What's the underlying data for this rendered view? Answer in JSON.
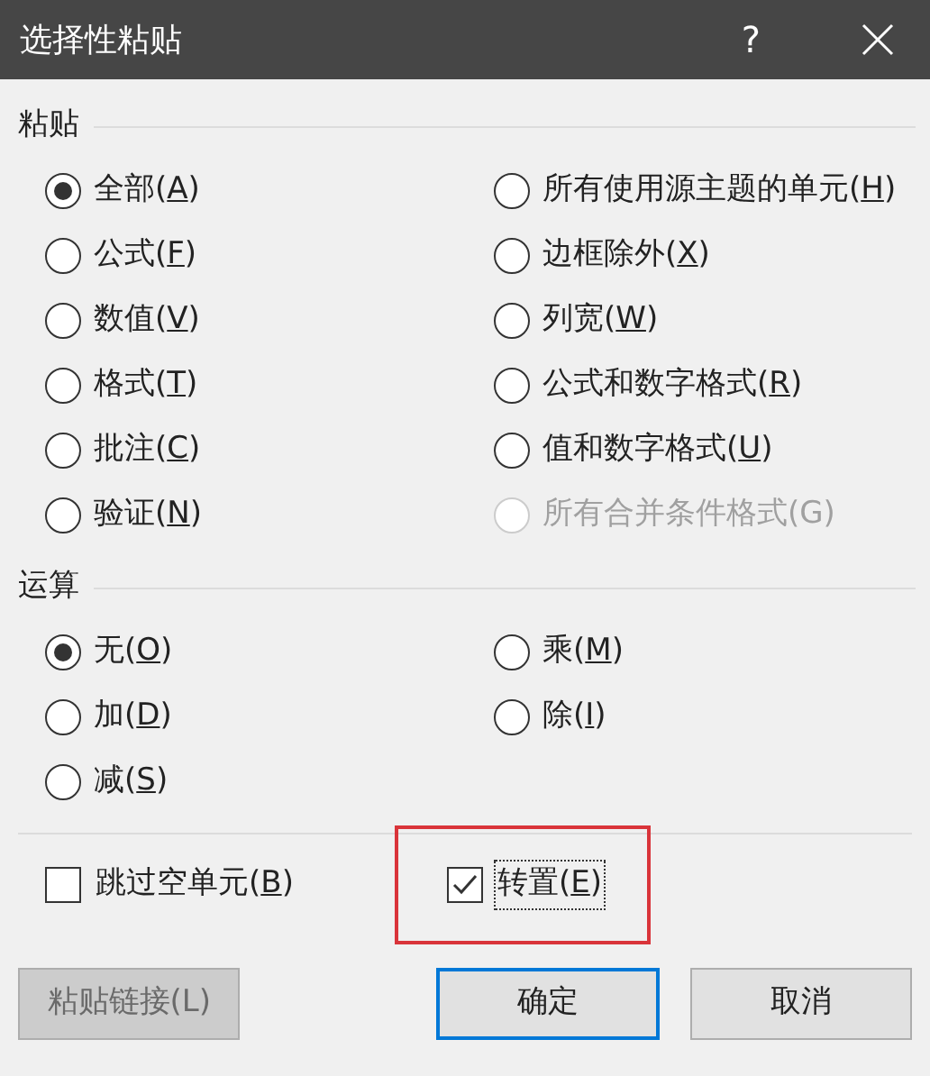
{
  "window": {
    "title": "选择性粘贴",
    "help": "?"
  },
  "paste": {
    "heading": "粘贴",
    "options": [
      {
        "label": "全部(A)",
        "selected": true,
        "disabled": false
      },
      {
        "label": "所有使用源主题的单元(H)",
        "selected": false,
        "disabled": false
      },
      {
        "label": "公式(F)",
        "selected": false,
        "disabled": false
      },
      {
        "label": "边框除外(X)",
        "selected": false,
        "disabled": false
      },
      {
        "label": "数值(V)",
        "selected": false,
        "disabled": false
      },
      {
        "label": "列宽(W)",
        "selected": false,
        "disabled": false
      },
      {
        "label": "格式(T)",
        "selected": false,
        "disabled": false
      },
      {
        "label": "公式和数字格式(R)",
        "selected": false,
        "disabled": false
      },
      {
        "label": "批注(C)",
        "selected": false,
        "disabled": false
      },
      {
        "label": "值和数字格式(U)",
        "selected": false,
        "disabled": false
      },
      {
        "label": "验证(N)",
        "selected": false,
        "disabled": false
      },
      {
        "label": "所有合并条件格式(G)",
        "selected": false,
        "disabled": true
      }
    ]
  },
  "operation": {
    "heading": "运算",
    "options": [
      {
        "label": "无(O)",
        "selected": true,
        "disabled": false
      },
      {
        "label": "乘(M)",
        "selected": false,
        "disabled": false
      },
      {
        "label": "加(D)",
        "selected": false,
        "disabled": false
      },
      {
        "label": "除(I)",
        "selected": false,
        "disabled": false
      },
      {
        "label": "减(S)",
        "selected": false,
        "disabled": false
      }
    ]
  },
  "checkboxes": [
    {
      "label": "跳过空单元(B)",
      "checked": false,
      "focused": false,
      "highlighted": false
    },
    {
      "label": "转置(E)",
      "checked": true,
      "focused": true,
      "highlighted": true
    }
  ],
  "buttons": [
    {
      "label": "粘贴链接(L)",
      "disabled": true,
      "default": false
    },
    {
      "label": "确定",
      "disabled": false,
      "default": true
    },
    {
      "label": "取消",
      "disabled": false,
      "default": false
    }
  ]
}
